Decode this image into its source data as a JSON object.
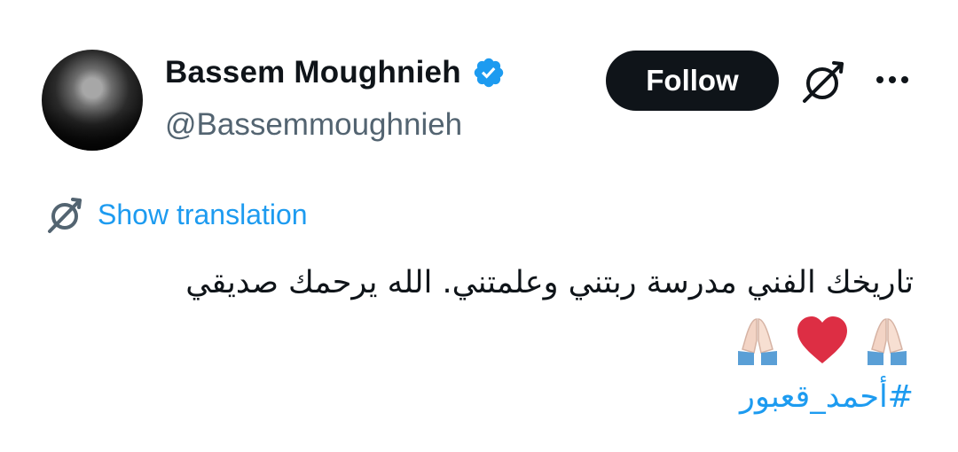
{
  "author": {
    "display_name": "Bassem Moughnieh",
    "handle": "@Bassemmoughnieh"
  },
  "actions": {
    "follow_label": "Follow",
    "grok_icon": "grok-icon",
    "more_icon": "more-icon"
  },
  "translation": {
    "label": "Show translation"
  },
  "tweet": {
    "text": "تاريخك الفني مدرسة ربتني وعلمتني. الله يرحمك صديقي",
    "emojis": [
      "folded-hands-icon",
      "red-heart-icon",
      "folded-hands-icon"
    ],
    "hashtag": "#أحمد_قعبور"
  },
  "colors": {
    "link_blue": "#1d9bf0",
    "verified_blue": "#1d9bf0",
    "text": "#0f1419",
    "secondary_text": "#536471",
    "button_bg": "#0f1419"
  }
}
